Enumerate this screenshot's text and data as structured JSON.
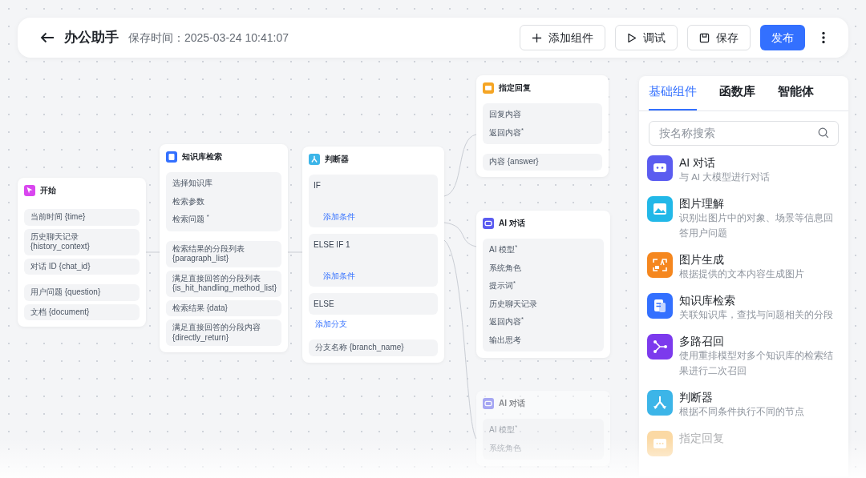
{
  "header": {
    "title": "办公助手",
    "save_time": "保存时间：2025-03-24 10:41:07",
    "buttons": [
      {
        "kind": "add",
        "label": "添加组件"
      },
      {
        "kind": "debug",
        "label": "调试"
      },
      {
        "kind": "save",
        "label": "保存"
      },
      {
        "kind": "publish",
        "label": "发布"
      }
    ]
  },
  "nodes": [
    {
      "kind": "start",
      "title": "开始",
      "faded": false,
      "sections": [
        {
          "kind": "rows",
          "items": [
            "当前时间 {time}",
            "历史聊天记录 {history_context}",
            "对话 ID {chat_id}"
          ]
        },
        {
          "kind": "rows",
          "items": [
            "用户问题 {question}",
            "文档 {document}"
          ]
        }
      ]
    },
    {
      "kind": "knowledge",
      "title": "知识库检索",
      "faded": false,
      "sections": [
        {
          "kind": "block",
          "items": [
            "选择知识库",
            "检索参数",
            "检索问题 $^{*}$"
          ]
        },
        {
          "kind": "rows",
          "items": [
            "检索结果的分段列表 {paragraph_list}",
            "满足直接回答的分段列表 {is_hit_handling_method_list}",
            "检索结果 {data}",
            "满足直接回答的分段内容 {directly_return}"
          ]
        }
      ]
    },
    {
      "kind": "condition",
      "title": "判断器",
      "faded": false,
      "sections": [
        {
          "kind": "branch",
          "label": "IF",
          "action": "添加条件"
        },
        {
          "kind": "branch",
          "label": "ELSE IF 1",
          "action": "添加条件"
        },
        {
          "kind": "else",
          "label": "ELSE",
          "action": "添加分支"
        },
        {
          "kind": "rows",
          "items": [
            "分支名称 {branch_name}"
          ]
        }
      ]
    },
    {
      "kind": "reply",
      "title": "指定回复",
      "faded": false,
      "sections": [
        {
          "kind": "block",
          "items": [
            "回复内容",
            "返回内容$^{*}$"
          ]
        },
        {
          "kind": "rows",
          "items": [
            "内容 {answer}"
          ]
        }
      ]
    },
    {
      "kind": "ai",
      "title": "AI 对话",
      "faded": false,
      "sections": [
        {
          "kind": "block",
          "items": [
            "AI 模型$^{*}$",
            "系统角色",
            "提示词$^{*}$",
            "历史聊天记录",
            "返回内容$^{*}$",
            "输出思考"
          ]
        }
      ]
    },
    {
      "kind": "ai",
      "title": "AI 对话",
      "faded": true,
      "sections": [
        {
          "kind": "block",
          "items": [
            "AI 模型$^{*}$",
            "系统角色"
          ]
        }
      ]
    }
  ],
  "panel": {
    "tabs": [
      {
        "label": "基础组件",
        "selected": true
      },
      {
        "label": "函数库",
        "selected": false
      },
      {
        "label": "智能体",
        "selected": false
      }
    ],
    "search": {
      "placeholder": "按名称搜索"
    },
    "items": [
      {
        "kind": "chat",
        "title": "AI 对话",
        "description": "与 AI 大模型进行对话",
        "color": "#5b5cf0",
        "faded": false
      },
      {
        "kind": "image",
        "title": "图片理解",
        "description": "识别出图片中的对象、场景等信息回答用户问题",
        "color": "#22b8e8",
        "faded": false
      },
      {
        "kind": "imagegen",
        "title": "图片生成",
        "description": "根据提供的文本内容生成图片",
        "color": "#f5871f",
        "faded": false
      },
      {
        "kind": "doc",
        "title": "知识库检索",
        "description": "关联知识库，查找与问题相关的分段",
        "color": "#3370ff",
        "faded": false
      },
      {
        "kind": "fork",
        "title": "多路召回",
        "description": "使用重排模型对多个知识库的检索结果进行二次召回",
        "color": "#7c3aed",
        "faded": false
      },
      {
        "kind": "branch",
        "title": "判断器",
        "description": "根据不同条件执行不同的节点",
        "color": "#3cb5e8",
        "faded": false
      },
      {
        "kind": "reply",
        "title": "指定回复",
        "color": "#fbd9a4",
        "faded": true
      }
    ]
  }
}
